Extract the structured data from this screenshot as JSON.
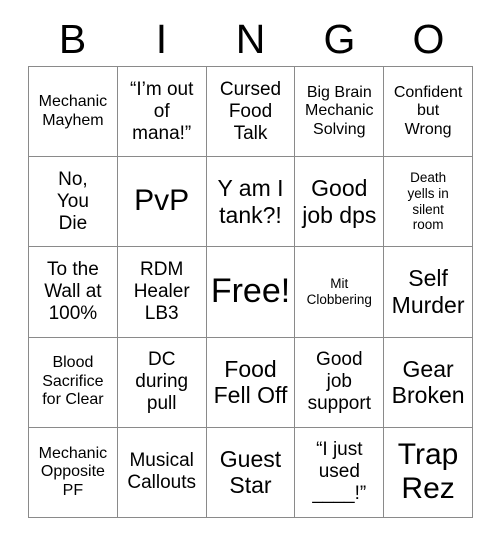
{
  "card": {
    "header_letters": [
      "B",
      "I",
      "N",
      "G",
      "O"
    ],
    "columns": 5,
    "rows": 5,
    "border_color": "#8a8a8a",
    "background_color": "#ffffff",
    "text_color": "#000000",
    "cells": [
      {
        "text": "Mechanic\nMayhem",
        "size": "s",
        "row": 1,
        "col": 1
      },
      {
        "text": "“I’m out\nof\nmana!”",
        "size": "m",
        "row": 1,
        "col": 2
      },
      {
        "text": "Cursed\nFood\nTalk",
        "size": "m",
        "row": 1,
        "col": 3
      },
      {
        "text": "Big Brain\nMechanic\nSolving",
        "size": "s",
        "row": 1,
        "col": 4
      },
      {
        "text": "Confident\nbut\nWrong",
        "size": "s",
        "row": 1,
        "col": 5
      },
      {
        "text": "No,\nYou\nDie",
        "size": "m",
        "row": 2,
        "col": 1
      },
      {
        "text": "PvP",
        "size": "xl",
        "row": 2,
        "col": 2
      },
      {
        "text": "Y am I\ntank?!",
        "size": "l",
        "row": 2,
        "col": 3
      },
      {
        "text": "Good\njob dps",
        "size": "l",
        "row": 2,
        "col": 4
      },
      {
        "text": "Death\nyells in\nsilent\nroom",
        "size": "xs",
        "row": 2,
        "col": 5
      },
      {
        "text": "To the\nWall at\n100%",
        "size": "m",
        "row": 3,
        "col": 1
      },
      {
        "text": "RDM\nHealer\nLB3",
        "size": "m",
        "row": 3,
        "col": 2
      },
      {
        "text": "Free!",
        "size": "xxl",
        "row": 3,
        "col": 3
      },
      {
        "text": "Mit\nClobbering",
        "size": "xs",
        "row": 3,
        "col": 4
      },
      {
        "text": "Self\nMurder",
        "size": "l",
        "row": 3,
        "col": 5
      },
      {
        "text": "Blood\nSacrifice\nfor Clear",
        "size": "s",
        "row": 4,
        "col": 1
      },
      {
        "text": "DC\nduring\npull",
        "size": "m",
        "row": 4,
        "col": 2
      },
      {
        "text": "Food\nFell Off",
        "size": "l",
        "row": 4,
        "col": 3
      },
      {
        "text": "Good\njob\nsupport",
        "size": "m",
        "row": 4,
        "col": 4
      },
      {
        "text": "Gear\nBroken",
        "size": "l",
        "row": 4,
        "col": 5
      },
      {
        "text": "Mechanic\nOpposite\nPF",
        "size": "s",
        "row": 5,
        "col": 1
      },
      {
        "text": "Musical\nCallouts",
        "size": "m",
        "row": 5,
        "col": 2
      },
      {
        "text": "Guest\nStar",
        "size": "l",
        "row": 5,
        "col": 3
      },
      {
        "text": "“I just\nused\n____!”",
        "size": "m",
        "row": 5,
        "col": 4
      },
      {
        "text": "Trap\nRez",
        "size": "xl",
        "row": 5,
        "col": 5
      }
    ]
  }
}
